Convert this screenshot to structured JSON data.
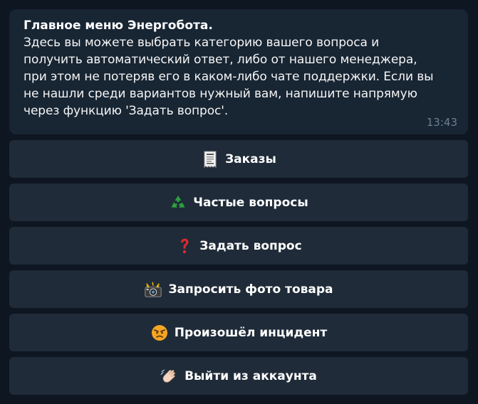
{
  "message": {
    "title": "Главное меню Энергобота.",
    "body": "Здесь вы можете выбрать категорию вашего вопроса и\nполучить автоматический ответ, либо от нашего менеджера,\nпри этом не потеряв его в каком-либо чате поддержки. Если вы\nне нашли среди вариантов нужный вам, напишите напрямую\nчерез функцию 'Задать вопрос'.",
    "time": "13:43"
  },
  "keyboard": [
    {
      "label": "Заказы",
      "icon": "receipt-icon"
    },
    {
      "label": "Частые вопросы",
      "icon": "recycle-icon"
    },
    {
      "label": "Задать вопрос",
      "icon": "red-question-mark-icon"
    },
    {
      "label": "Запросить фото товара",
      "icon": "camera-flash-icon"
    },
    {
      "label": "Произошёл инцидент",
      "icon": "angry-face-icon"
    },
    {
      "label": "Выйти из аккаунта",
      "icon": "waving-hand-icon"
    }
  ],
  "colors": {
    "background": "#0e1621",
    "message_bubble": "#182533",
    "button": "#1f2b38",
    "timestamp": "#6d7f8f"
  }
}
